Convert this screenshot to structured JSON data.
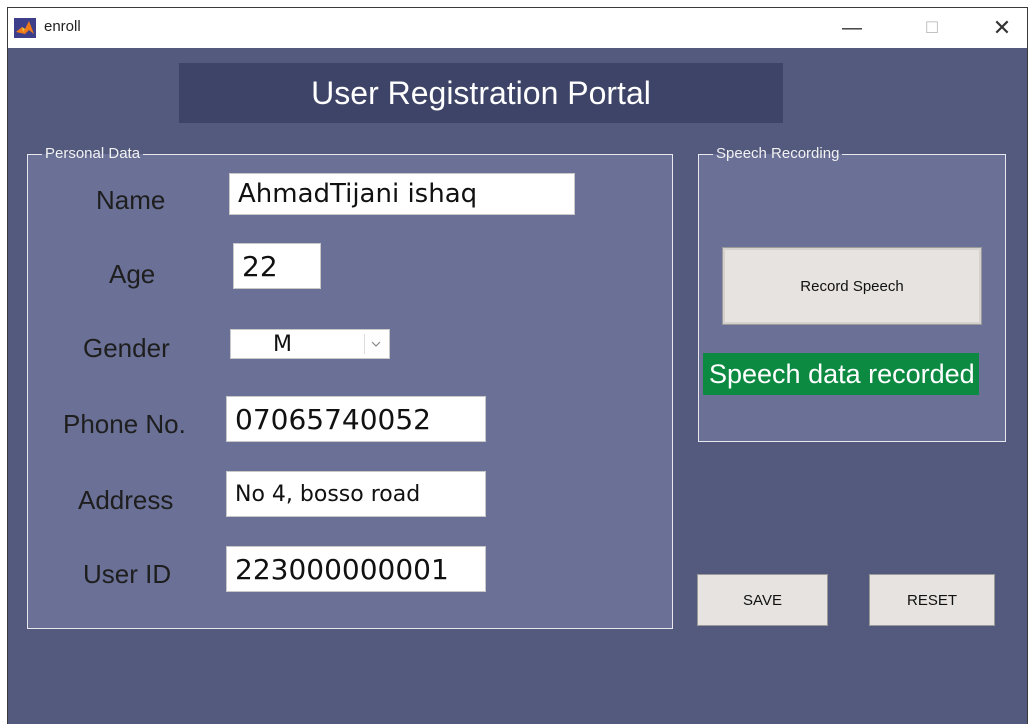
{
  "window": {
    "title": "enroll",
    "controls": {
      "minimize": "—",
      "maximize": "☐",
      "close": "✕"
    },
    "icon": "matlab-icon"
  },
  "header": {
    "title": "User Registration Portal"
  },
  "personal_data": {
    "title": "Personal Data",
    "fields": {
      "name": {
        "label": "Name",
        "value": "AhmadTijani ishaq"
      },
      "age": {
        "label": "Age",
        "value": "22"
      },
      "gender": {
        "label": "Gender",
        "value": "M"
      },
      "phone": {
        "label": "Phone No.",
        "value": "07065740052"
      },
      "address": {
        "label": "Address",
        "value": "No 4, bosso road"
      },
      "user_id": {
        "label": "User ID",
        "value": "223000000001"
      }
    }
  },
  "speech_recording": {
    "title": "Speech Recording",
    "record_button": "Record Speech",
    "status": "Speech data recorded"
  },
  "actions": {
    "save": "SAVE",
    "reset": "RESET"
  },
  "colors": {
    "background": "#535a7e",
    "panel": "#6a7096",
    "header": "#3e4468",
    "status_green": "#0d8a42"
  }
}
